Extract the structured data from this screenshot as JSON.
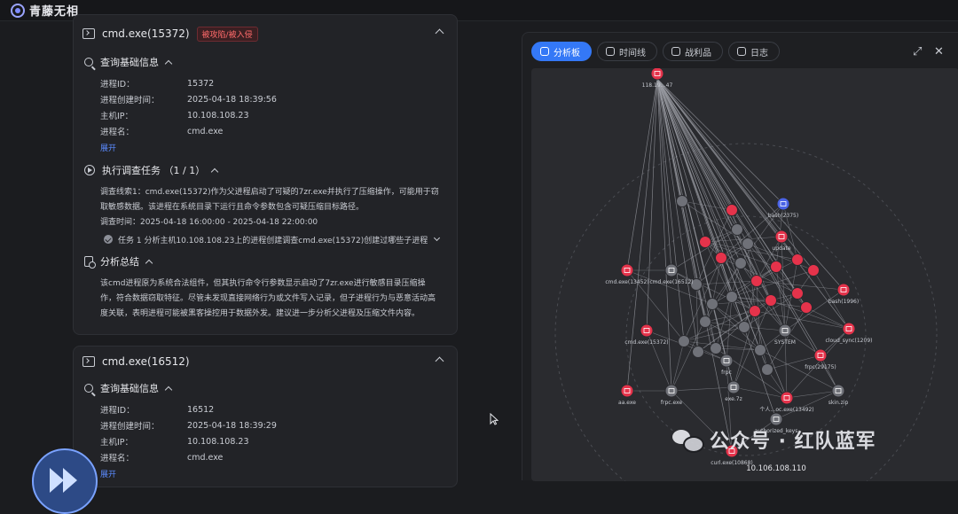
{
  "app": {
    "brand": "青藤无相"
  },
  "cards": [
    {
      "title": "cmd.exe(15372)",
      "tag": "被攻陷/被入侵",
      "basic": {
        "title": "查询基础信息",
        "rows": [
          {
            "k": "进程ID：",
            "v": "15372"
          },
          {
            "k": "进程创建时间：",
            "v": "2025-04-18 18:39:56"
          },
          {
            "k": "主机IP：",
            "v": "10.108.108.23"
          },
          {
            "k": "进程名：",
            "v": "cmd.exe"
          }
        ],
        "expand": "展开"
      },
      "task": {
        "title": "执行调查任务 （1 / 1）",
        "clue": "调查线索1：cmd.exe(15372)作为父进程启动了可疑的7zr.exe并执行了压缩操作，可能用于窃取敏感数据。该进程在系统目录下运行且命令参数包含可疑压缩目标路径。",
        "time": "调查时间：2025-04-18 16:00:00 - 2025-04-18 22:00:00",
        "item": "任务 1 分析主机10.108.108.23上的进程创建调查cmd.exe(15372)创建过哪些子进程"
      },
      "summary": {
        "title": "分析总结",
        "text": "该cmd进程原为系统合法组件，但其执行命令行参数显示启动了7zr.exe进行敏感目录压缩操作，符合数据窃取特征。尽管未发现直接网络行为或文件写入记录，但子进程行为与恶意活动高度关联，表明进程可能被黑客操控用于数据外发。建议进一步分析父进程及压缩文件内容。"
      }
    },
    {
      "title": "cmd.exe(16512)",
      "basic": {
        "title": "查询基础信息",
        "rows": [
          {
            "k": "进程ID：",
            "v": "16512"
          },
          {
            "k": "进程创建时间：",
            "v": "2025-04-18 18:39:29"
          },
          {
            "k": "主机IP：",
            "v": "10.108.108.23"
          },
          {
            "k": "进程名：",
            "v": "cmd.exe"
          }
        ],
        "expand": "展开"
      }
    }
  ],
  "panel": {
    "tabs": [
      {
        "label": "分析板",
        "icon": "graph-icon",
        "active": true
      },
      {
        "label": "时间线",
        "icon": "timeline-icon",
        "active": false
      },
      {
        "label": "战利品",
        "icon": "trophy-icon",
        "active": false
      },
      {
        "label": "日志",
        "icon": "log-icon",
        "active": false
      }
    ],
    "expand_glyph": "⤢",
    "close_glyph": "✕",
    "graph": {
      "colors": {
        "red": "#e5334b",
        "gray": "#6f7178",
        "blue": "#4a63e6",
        "edge": "#9a9ca3"
      },
      "hub": {
        "label": "118.193.…47"
      },
      "host_label": "10.106.108.110",
      "nodes": [
        {
          "id": "ip-118",
          "label": "118.19…47",
          "kind": "red"
        },
        {
          "id": "bash2375",
          "label": "bash(2375)",
          "kind": "blue"
        },
        {
          "id": "cmd13452",
          "label": "cmd.exe(13452)",
          "kind": "red"
        },
        {
          "id": "cmd16512",
          "label": "cmd.exe(16512)",
          "kind": "gray"
        },
        {
          "id": "bash1996",
          "label": "bash(1996)",
          "kind": "red"
        },
        {
          "id": "cmd15372",
          "label": "cmd.exe(15372)",
          "kind": "red"
        },
        {
          "id": "frpc",
          "label": "frpc",
          "kind": "gray"
        },
        {
          "id": "sync1209",
          "label": "cloud_sync(1209)",
          "kind": "red"
        },
        {
          "id": "frpc29175",
          "label": "frpc(29175)",
          "kind": "red"
        },
        {
          "id": "aa",
          "label": "aa.exe",
          "kind": "red"
        },
        {
          "id": "frpcexe",
          "label": "frpc.exe",
          "kind": "gray"
        },
        {
          "id": "exe7z",
          "label": "exe.7z",
          "kind": "gray"
        },
        {
          "id": "proc13492",
          "label": "个人…oc.exe(13492)",
          "kind": "red"
        },
        {
          "id": "skin",
          "label": "skin.zip",
          "kind": "gray"
        },
        {
          "id": "authkeys",
          "label": "authorized_keys",
          "kind": "gray"
        },
        {
          "id": "curl10868",
          "label": "curl.exe(10868)",
          "kind": "red"
        },
        {
          "id": "update",
          "label": "update",
          "kind": "red"
        },
        {
          "id": "system",
          "label": "SYSTEM",
          "kind": "gray"
        }
      ]
    }
  },
  "watermark": {
    "text": "公众号 · 红队蓝军"
  }
}
